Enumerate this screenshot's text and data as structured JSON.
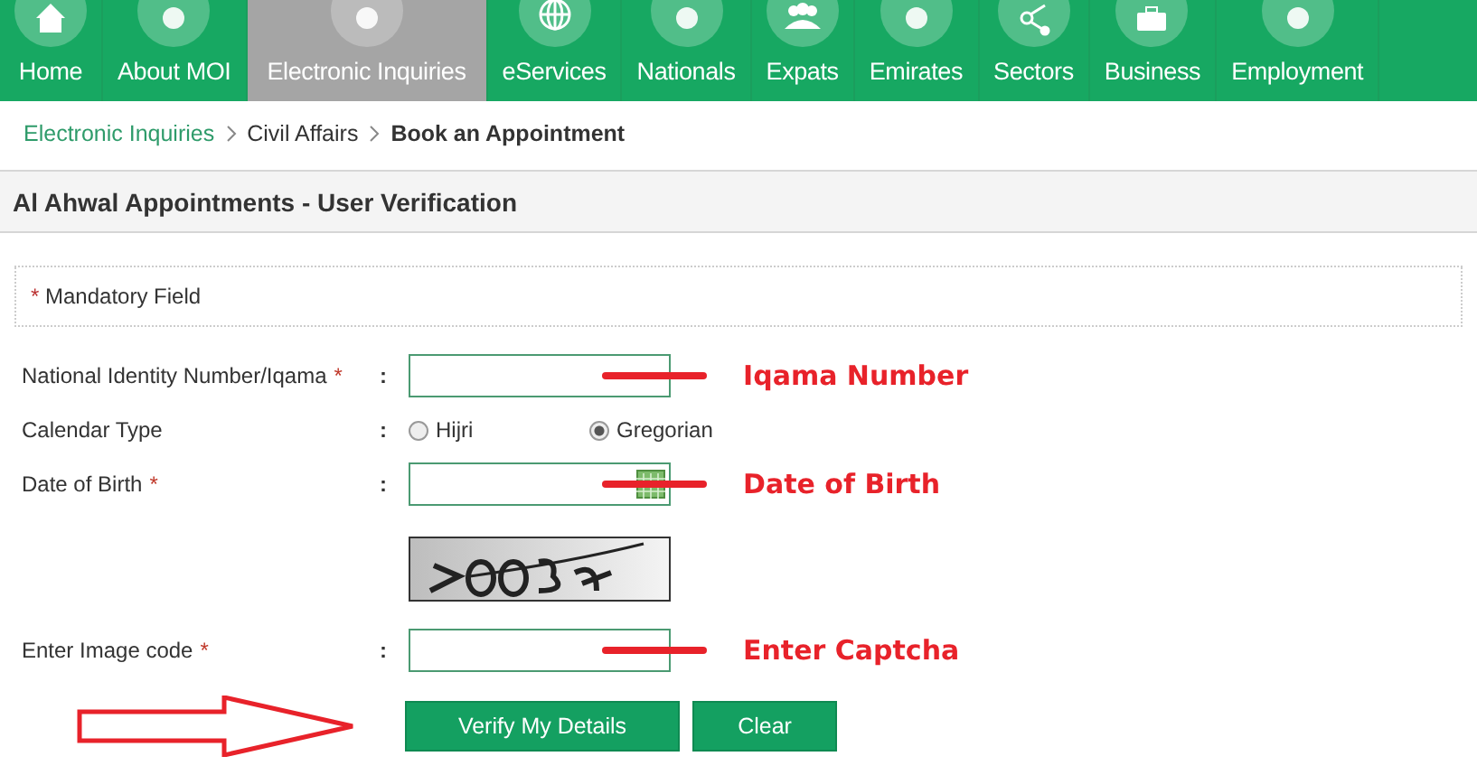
{
  "nav": {
    "items": [
      {
        "label": "Home",
        "selected": false
      },
      {
        "label": "About MOI",
        "selected": false
      },
      {
        "label": "Electronic Inquiries",
        "selected": true
      },
      {
        "label": "eServices",
        "selected": false
      },
      {
        "label": "Nationals",
        "selected": false
      },
      {
        "label": "Expats",
        "selected": false
      },
      {
        "label": "Emirates",
        "selected": false
      },
      {
        "label": "Sectors",
        "selected": false
      },
      {
        "label": "Business",
        "selected": false
      },
      {
        "label": "Employment",
        "selected": false
      }
    ]
  },
  "breadcrumb": [
    {
      "label": "Electronic Inquiries",
      "kind": "link"
    },
    {
      "label": "Civil Affairs",
      "kind": "link"
    },
    {
      "label": "Book an Appointment",
      "kind": "current"
    }
  ],
  "panel": {
    "title": "Al Ahwal Appointments - User Verification"
  },
  "mandatory_note": {
    "mark": "*",
    "text": "Mandatory Field"
  },
  "form": {
    "rows": [
      {
        "kind": "text",
        "label": "National Identity Number/Iqama",
        "required": true,
        "annotation": "Iqama Number"
      },
      {
        "kind": "radio",
        "label": "Calendar Type",
        "required": false,
        "options": [
          {
            "label": "Hijri",
            "selected": false
          },
          {
            "label": "Gregorian",
            "selected": true
          }
        ]
      },
      {
        "kind": "date",
        "label": "Date of Birth",
        "required": true,
        "annotation": "Date of Birth"
      },
      {
        "kind": "captcha"
      },
      {
        "kind": "text",
        "label": "Enter Image code",
        "required": true,
        "annotation": "Enter Captcha"
      }
    ],
    "separator": ":",
    "buttons": [
      "Verify My Details",
      "Clear"
    ]
  }
}
